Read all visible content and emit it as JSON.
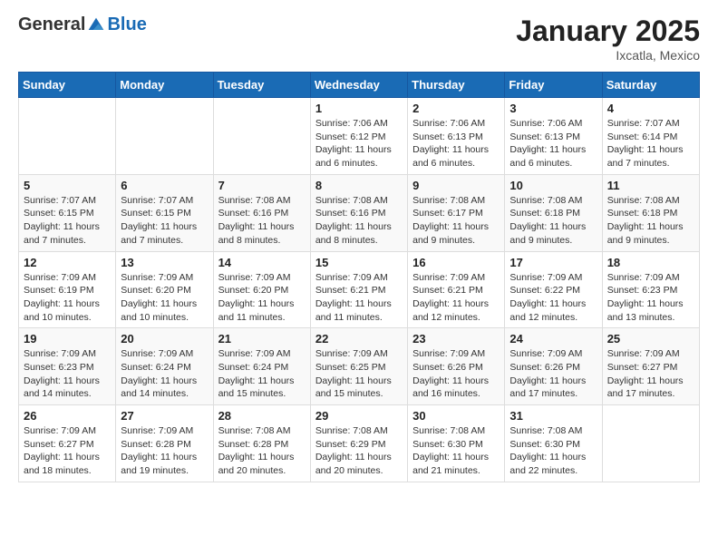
{
  "logo": {
    "general": "General",
    "blue": "Blue"
  },
  "header": {
    "title": "January 2025",
    "location": "Ixcatla, Mexico"
  },
  "weekdays": [
    "Sunday",
    "Monday",
    "Tuesday",
    "Wednesday",
    "Thursday",
    "Friday",
    "Saturday"
  ],
  "weeks": [
    [
      {
        "day": "",
        "info": ""
      },
      {
        "day": "",
        "info": ""
      },
      {
        "day": "",
        "info": ""
      },
      {
        "day": "1",
        "info": "Sunrise: 7:06 AM\nSunset: 6:12 PM\nDaylight: 11 hours and 6 minutes."
      },
      {
        "day": "2",
        "info": "Sunrise: 7:06 AM\nSunset: 6:13 PM\nDaylight: 11 hours and 6 minutes."
      },
      {
        "day": "3",
        "info": "Sunrise: 7:06 AM\nSunset: 6:13 PM\nDaylight: 11 hours and 6 minutes."
      },
      {
        "day": "4",
        "info": "Sunrise: 7:07 AM\nSunset: 6:14 PM\nDaylight: 11 hours and 7 minutes."
      }
    ],
    [
      {
        "day": "5",
        "info": "Sunrise: 7:07 AM\nSunset: 6:15 PM\nDaylight: 11 hours and 7 minutes."
      },
      {
        "day": "6",
        "info": "Sunrise: 7:07 AM\nSunset: 6:15 PM\nDaylight: 11 hours and 7 minutes."
      },
      {
        "day": "7",
        "info": "Sunrise: 7:08 AM\nSunset: 6:16 PM\nDaylight: 11 hours and 8 minutes."
      },
      {
        "day": "8",
        "info": "Sunrise: 7:08 AM\nSunset: 6:16 PM\nDaylight: 11 hours and 8 minutes."
      },
      {
        "day": "9",
        "info": "Sunrise: 7:08 AM\nSunset: 6:17 PM\nDaylight: 11 hours and 9 minutes."
      },
      {
        "day": "10",
        "info": "Sunrise: 7:08 AM\nSunset: 6:18 PM\nDaylight: 11 hours and 9 minutes."
      },
      {
        "day": "11",
        "info": "Sunrise: 7:08 AM\nSunset: 6:18 PM\nDaylight: 11 hours and 9 minutes."
      }
    ],
    [
      {
        "day": "12",
        "info": "Sunrise: 7:09 AM\nSunset: 6:19 PM\nDaylight: 11 hours and 10 minutes."
      },
      {
        "day": "13",
        "info": "Sunrise: 7:09 AM\nSunset: 6:20 PM\nDaylight: 11 hours and 10 minutes."
      },
      {
        "day": "14",
        "info": "Sunrise: 7:09 AM\nSunset: 6:20 PM\nDaylight: 11 hours and 11 minutes."
      },
      {
        "day": "15",
        "info": "Sunrise: 7:09 AM\nSunset: 6:21 PM\nDaylight: 11 hours and 11 minutes."
      },
      {
        "day": "16",
        "info": "Sunrise: 7:09 AM\nSunset: 6:21 PM\nDaylight: 11 hours and 12 minutes."
      },
      {
        "day": "17",
        "info": "Sunrise: 7:09 AM\nSunset: 6:22 PM\nDaylight: 11 hours and 12 minutes."
      },
      {
        "day": "18",
        "info": "Sunrise: 7:09 AM\nSunset: 6:23 PM\nDaylight: 11 hours and 13 minutes."
      }
    ],
    [
      {
        "day": "19",
        "info": "Sunrise: 7:09 AM\nSunset: 6:23 PM\nDaylight: 11 hours and 14 minutes."
      },
      {
        "day": "20",
        "info": "Sunrise: 7:09 AM\nSunset: 6:24 PM\nDaylight: 11 hours and 14 minutes."
      },
      {
        "day": "21",
        "info": "Sunrise: 7:09 AM\nSunset: 6:24 PM\nDaylight: 11 hours and 15 minutes."
      },
      {
        "day": "22",
        "info": "Sunrise: 7:09 AM\nSunset: 6:25 PM\nDaylight: 11 hours and 15 minutes."
      },
      {
        "day": "23",
        "info": "Sunrise: 7:09 AM\nSunset: 6:26 PM\nDaylight: 11 hours and 16 minutes."
      },
      {
        "day": "24",
        "info": "Sunrise: 7:09 AM\nSunset: 6:26 PM\nDaylight: 11 hours and 17 minutes."
      },
      {
        "day": "25",
        "info": "Sunrise: 7:09 AM\nSunset: 6:27 PM\nDaylight: 11 hours and 17 minutes."
      }
    ],
    [
      {
        "day": "26",
        "info": "Sunrise: 7:09 AM\nSunset: 6:27 PM\nDaylight: 11 hours and 18 minutes."
      },
      {
        "day": "27",
        "info": "Sunrise: 7:09 AM\nSunset: 6:28 PM\nDaylight: 11 hours and 19 minutes."
      },
      {
        "day": "28",
        "info": "Sunrise: 7:08 AM\nSunset: 6:28 PM\nDaylight: 11 hours and 20 minutes."
      },
      {
        "day": "29",
        "info": "Sunrise: 7:08 AM\nSunset: 6:29 PM\nDaylight: 11 hours and 20 minutes."
      },
      {
        "day": "30",
        "info": "Sunrise: 7:08 AM\nSunset: 6:30 PM\nDaylight: 11 hours and 21 minutes."
      },
      {
        "day": "31",
        "info": "Sunrise: 7:08 AM\nSunset: 6:30 PM\nDaylight: 11 hours and 22 minutes."
      },
      {
        "day": "",
        "info": ""
      }
    ]
  ]
}
